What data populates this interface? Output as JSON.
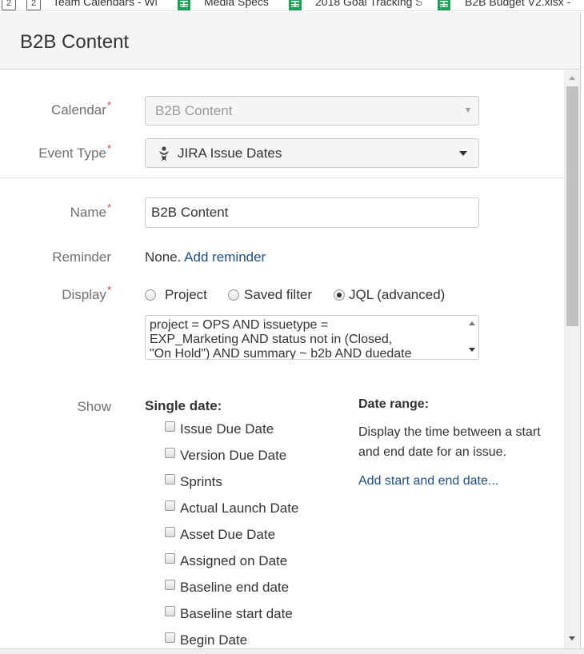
{
  "bookmarks": {
    "counter_a": "2",
    "counter_b": "2",
    "items": [
      "Team Calendars - Wi",
      "Media Specs",
      "2018 Goal Tracking S",
      "B2B Budget V2.xlsx -"
    ]
  },
  "dialog": {
    "title": "B2B Content"
  },
  "form": {
    "calendar": {
      "label": "Calendar",
      "required": "*",
      "value": "B2B Content"
    },
    "event_type": {
      "label": "Event Type",
      "required": "*",
      "value": "JIRA Issue Dates",
      "icon": "jira-icon"
    },
    "name": {
      "label": "Name",
      "required": "*",
      "value": "B2B Content"
    },
    "reminder": {
      "label": "Reminder",
      "value": "None.",
      "link": "Add reminder"
    },
    "display": {
      "label": "Display",
      "required": "*",
      "options": [
        "Project",
        "Saved filter",
        "JQL (advanced)"
      ],
      "selected": "JQL (advanced)",
      "jql": "project = OPS AND issuetype =\nEXP_Marketing AND status not in (Closed,\n\"On Hold\") AND summary ~ b2b AND duedate"
    },
    "show": {
      "label": "Show",
      "single_date_heading": "Single date:",
      "single_date_options": [
        "Issue Due Date",
        "Version Due Date",
        "Sprints",
        "Actual Launch Date",
        "Asset Due Date",
        "Assigned on Date",
        "Baseline end date",
        "Baseline start date",
        "Begin Date"
      ],
      "date_range_heading": "Date range:",
      "date_range_description": "Display the time between a start and end date for an issue.",
      "date_range_link": "Add start and end date..."
    }
  },
  "colors": {
    "link": "#205081",
    "required": "#d04437",
    "label": "#707070"
  }
}
